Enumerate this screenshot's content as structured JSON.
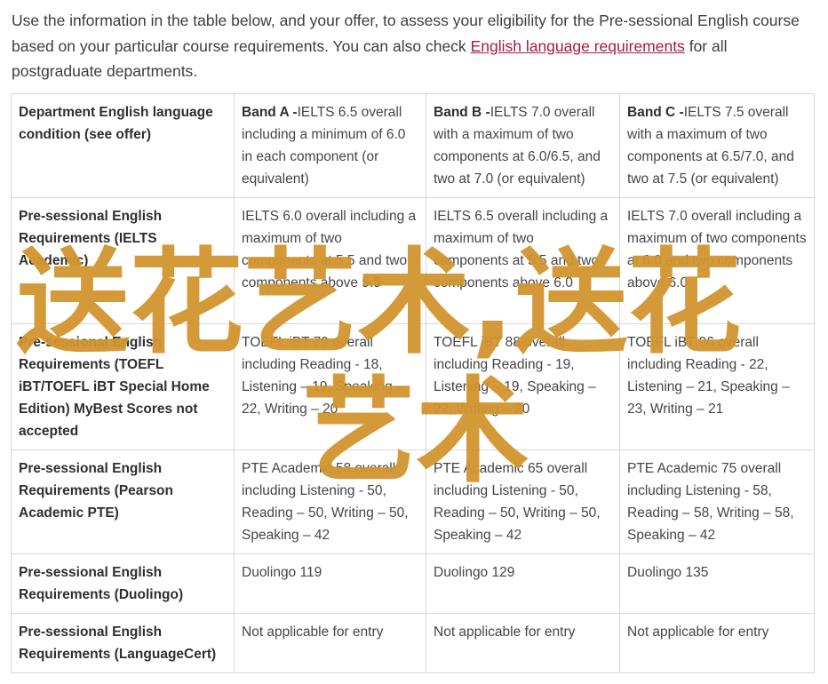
{
  "intro": {
    "text_before": "Use the information in the table below, and your offer, to assess your eligibility for the Pre-sessional English course based on your particular course requirements. You can also check ",
    "link_text": "English language requirements",
    "text_after": " for all postgraduate departments."
  },
  "table": {
    "rows": [
      {
        "label": "Department English language condition (see offer)",
        "cells": [
          {
            "strong": "Band A -",
            "text": "IELTS 6.5 overall including a minimum of 6.0 in each component (or equivalent)"
          },
          {
            "strong": "Band B -",
            "text": "IELTS 7.0 overall with a maximum of two components at 6.0/6.5, and two at 7.0 (or equivalent)"
          },
          {
            "strong": "Band C -",
            "text": "IELTS 7.5 overall with a maximum of two components at 6.5/7.0, and two at 7.5 (or equivalent)"
          }
        ]
      },
      {
        "label": "Pre-sessional English Requirements (IELTS Academic)",
        "cells": [
          {
            "text": "IELTS 6.0 overall including a maximum of two components at 5.5 and two components above 5.5"
          },
          {
            "text": "IELTS 6.5 overall including a maximum of two components at 5.5 and two components above 6.0"
          },
          {
            "text": "IELTS 7.0 overall including a maximum of two components at 6.0 and two components above 6.0"
          }
        ]
      },
      {
        "label": "Pre-sessional English Requirements (TOEFL iBT/TOEFL iBT Special Home Edition) MyBest Scores not accepted",
        "cells": [
          {
            "text": "TOEFL iBT 79 overall including Reading - 18, Listening – 19, Speaking – 22, Writing – 20"
          },
          {
            "text": "TOEFL iBT 88 overall including Reading - 19, Listening – 19, Speaking – 22, Writing – 20"
          },
          {
            "text": "TOEFL iBT 96 overall including Reading - 22, Listening – 21, Speaking – 23, Writing – 21"
          }
        ]
      },
      {
        "label": "Pre-sessional English Requirements (Pearson Academic PTE)",
        "cells": [
          {
            "text": "PTE Academic 58 overall including Listening - 50, Reading – 50, Writing – 50, Speaking – 42"
          },
          {
            "text": "PTE Academic 65 overall including Listening - 50, Reading – 50, Writing – 50, Speaking – 42"
          },
          {
            "text": "PTE Academic 75 overall including Listening - 58, Reading – 58, Writing – 58, Speaking – 42"
          }
        ]
      },
      {
        "label": "Pre-sessional English Requirements (Duolingo)",
        "cells": [
          {
            "text": "Duolingo 119"
          },
          {
            "text": "Duolingo 129"
          },
          {
            "text": "Duolingo 135"
          }
        ]
      },
      {
        "label": "Pre-sessional English Requirements (LanguageCert)",
        "cells": [
          {
            "text": "Not applicable for entry"
          },
          {
            "text": "Not applicable for entry"
          },
          {
            "text": "Not applicable for entry"
          }
        ]
      }
    ]
  },
  "watermark": {
    "line1": "送花艺术,送花",
    "line2": "艺术",
    "color": "#d2952f"
  },
  "colors": {
    "link": "#a31c3f",
    "border": "#d8d8d8",
    "text": "#454545"
  }
}
